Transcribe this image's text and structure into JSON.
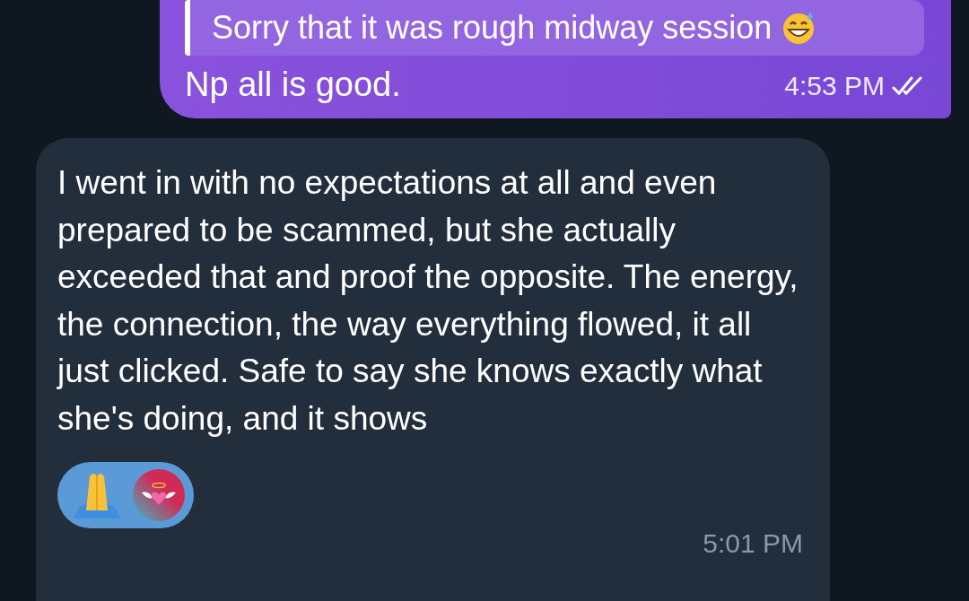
{
  "messages": [
    {
      "kind": "outgoing",
      "quote": "Sorry that it was rough midway session",
      "text": "Np all is good.",
      "time": "4:53 PM",
      "read": true
    },
    {
      "kind": "incoming",
      "text": "I went in with no expectations at all and even prepared to be scammed, but she actually exceeded that and proof the opposite. The energy, the connection, the way everything flowed, it all just clicked. Safe to say she knows exactly what she's doing, and it shows",
      "time": "5:01 PM",
      "reactions": [
        {
          "kind": "emoji"
        },
        {
          "kind": "avatar"
        }
      ]
    }
  ]
}
